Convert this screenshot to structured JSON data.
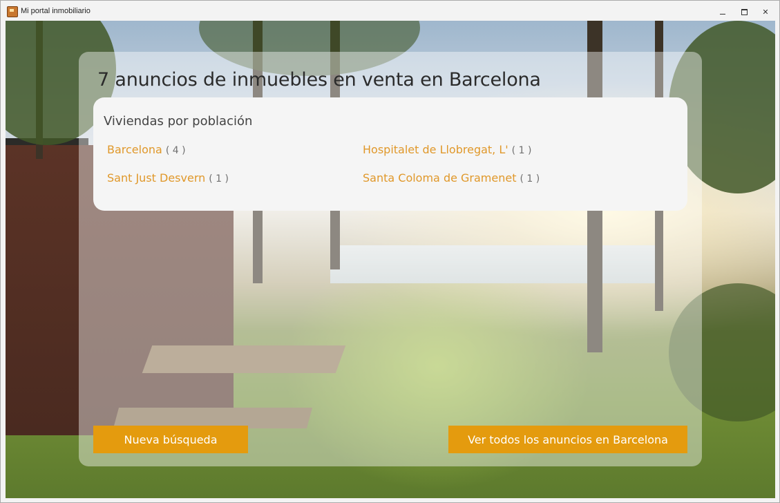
{
  "window": {
    "title": "Mi portal inmobiliario",
    "controls": {
      "minimize": "—",
      "maximize": "▢",
      "close": "✕"
    }
  },
  "main": {
    "heading": "7 anuncios de inmuebles en venta en Barcelona",
    "card": {
      "title": "Viviendas por población",
      "cities": [
        {
          "name": "Barcelona",
          "count": "( 4 )"
        },
        {
          "name": "Hospitalet de Llobregat, L'",
          "count": "( 1 )"
        },
        {
          "name": "Sant Just Desvern",
          "count": "( 1 )"
        },
        {
          "name": "Santa Coloma de Gramenet",
          "count": "( 1 )"
        }
      ]
    },
    "buttons": {
      "new_search": "Nueva búsqueda",
      "view_all": "Ver todos los anuncios en Barcelona"
    }
  },
  "colors": {
    "accent": "#e49b0e",
    "link": "#e0982a",
    "count": "#707070"
  },
  "icons": {
    "app": "house-icon",
    "minimize": "minimize-icon",
    "maximize": "maximize-icon",
    "close": "close-icon"
  }
}
